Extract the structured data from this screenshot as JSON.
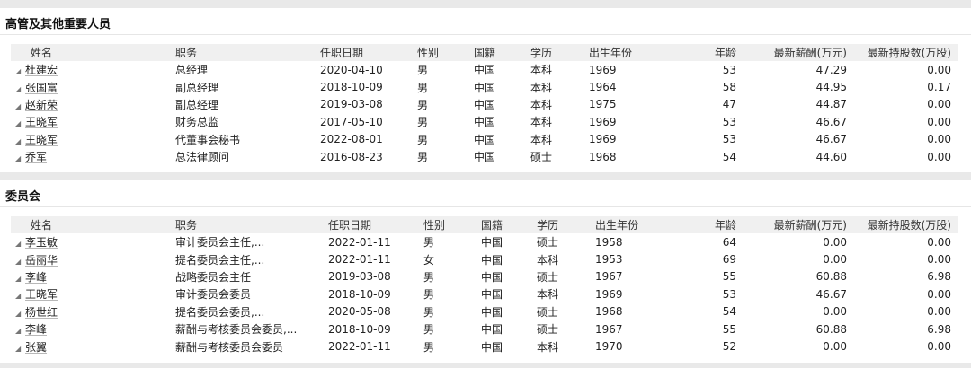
{
  "sections": {
    "management": {
      "title": "高管及其他重要人员",
      "headers": [
        "姓名",
        "职务",
        "任职日期",
        "性别",
        "国籍",
        "学历",
        "出生年份",
        "年龄",
        "最新薪酬(万元)",
        "最新持股数(万股)"
      ],
      "rows": [
        {
          "name": "杜建宏",
          "position": "总经理",
          "date": "2020-04-10",
          "gender": "男",
          "nationality": "中国",
          "education": "本科",
          "birth_year": "1969",
          "age": "53",
          "salary": "47.29",
          "shares": "0.00"
        },
        {
          "name": "张国富",
          "position": "副总经理",
          "date": "2018-10-09",
          "gender": "男",
          "nationality": "中国",
          "education": "本科",
          "birth_year": "1964",
          "age": "58",
          "salary": "44.95",
          "shares": "0.17"
        },
        {
          "name": "赵新荣",
          "position": "副总经理",
          "date": "2019-03-08",
          "gender": "男",
          "nationality": "中国",
          "education": "本科",
          "birth_year": "1975",
          "age": "47",
          "salary": "44.87",
          "shares": "0.00"
        },
        {
          "name": "王晓军",
          "position": "财务总监",
          "date": "2017-05-10",
          "gender": "男",
          "nationality": "中国",
          "education": "本科",
          "birth_year": "1969",
          "age": "53",
          "salary": "46.67",
          "shares": "0.00"
        },
        {
          "name": "王晓军",
          "position": "代董事会秘书",
          "date": "2022-08-01",
          "gender": "男",
          "nationality": "中国",
          "education": "本科",
          "birth_year": "1969",
          "age": "53",
          "salary": "46.67",
          "shares": "0.00"
        },
        {
          "name": "乔军",
          "position": "总法律顾问",
          "date": "2016-08-23",
          "gender": "男",
          "nationality": "中国",
          "education": "硕士",
          "birth_year": "1968",
          "age": "54",
          "salary": "44.60",
          "shares": "0.00"
        }
      ]
    },
    "committee": {
      "title": "委员会",
      "headers": [
        "姓名",
        "职务",
        "任职日期",
        "性别",
        "国籍",
        "学历",
        "出生年份",
        "年龄",
        "最新薪酬(万元)",
        "最新持股数(万股)"
      ],
      "rows": [
        {
          "name": "李玉敏",
          "position": "审计委员会主任,...",
          "date": "2022-01-11",
          "gender": "男",
          "nationality": "中国",
          "education": "硕士",
          "birth_year": "1958",
          "age": "64",
          "salary": "0.00",
          "shares": "0.00"
        },
        {
          "name": "岳丽华",
          "position": "提名委员会主任,...",
          "date": "2022-01-11",
          "gender": "女",
          "nationality": "中国",
          "education": "本科",
          "birth_year": "1953",
          "age": "69",
          "salary": "0.00",
          "shares": "0.00"
        },
        {
          "name": "李峰",
          "position": "战略委员会主任",
          "date": "2019-03-08",
          "gender": "男",
          "nationality": "中国",
          "education": "硕士",
          "birth_year": "1967",
          "age": "55",
          "salary": "60.88",
          "shares": "6.98"
        },
        {
          "name": "王晓军",
          "position": "审计委员会委员",
          "date": "2018-10-09",
          "gender": "男",
          "nationality": "中国",
          "education": "本科",
          "birth_year": "1969",
          "age": "53",
          "salary": "46.67",
          "shares": "0.00"
        },
        {
          "name": "杨世红",
          "position": "提名委员会委员,...",
          "date": "2020-05-08",
          "gender": "男",
          "nationality": "中国",
          "education": "硕士",
          "birth_year": "1968",
          "age": "54",
          "salary": "0.00",
          "shares": "0.00"
        },
        {
          "name": "李峰",
          "position": "薪酬与考核委员会委员,...",
          "date": "2018-10-09",
          "gender": "男",
          "nationality": "中国",
          "education": "硕士",
          "birth_year": "1967",
          "age": "55",
          "salary": "60.88",
          "shares": "6.98"
        },
        {
          "name": "张翼",
          "position": "薪酬与考核委员会委员",
          "date": "2022-01-11",
          "gender": "男",
          "nationality": "中国",
          "education": "本科",
          "birth_year": "1970",
          "age": "52",
          "salary": "0.00",
          "shares": "0.00"
        }
      ]
    }
  }
}
